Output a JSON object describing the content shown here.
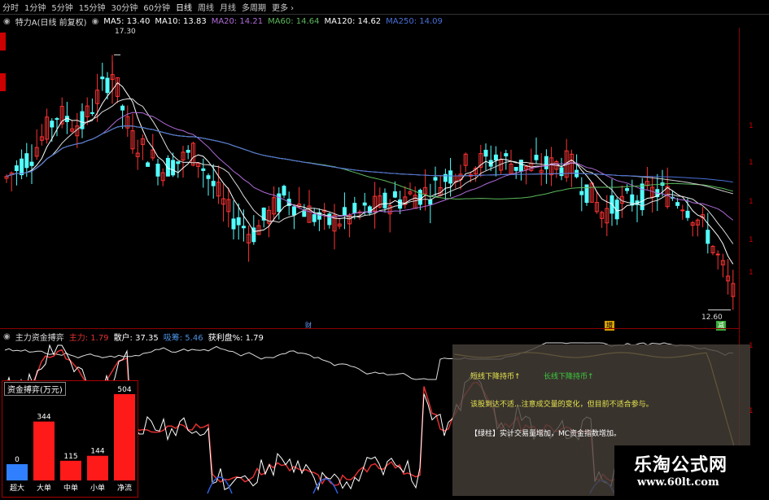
{
  "period_tabs": [
    {
      "label": "分时"
    },
    {
      "label": "1分钟"
    },
    {
      "label": "5分钟"
    },
    {
      "label": "15分钟"
    },
    {
      "label": "30分钟"
    },
    {
      "label": "60分钟"
    },
    {
      "label": "日线"
    },
    {
      "label": "周线"
    },
    {
      "label": "月线"
    },
    {
      "label": "多周期"
    },
    {
      "label": "更多 ›"
    }
  ],
  "main": {
    "title": "特力A(日线 前复权)",
    "ma": [
      {
        "label": "MA5: 13.40",
        "color": "#ffffff"
      },
      {
        "label": "MA10: 13.83",
        "color": "#ffffff"
      },
      {
        "label": "MA20: 14.21",
        "color": "#b06ad8"
      },
      {
        "label": "MA60: 14.64",
        "color": "#5cb85c"
      },
      {
        "label": "MA120: 14.62",
        "color": "#ffffff"
      },
      {
        "label": "MA250: 14.09",
        "color": "#4a70d8"
      }
    ],
    "high_label": "17.30",
    "low_label": "12.60",
    "markers": {
      "cai": "财",
      "zeng": "增",
      "jian": "减"
    }
  },
  "sub": {
    "title": "主力资金搏弈",
    "stats": [
      {
        "label": "主力: 1.79",
        "color": "#e03030"
      },
      {
        "label": "散户: 37.35",
        "color": "#ffffff"
      },
      {
        "label": "吸筹: 5.46",
        "color": "#4a90e0"
      },
      {
        "label": "获利盘%: 1.79",
        "color": "#ffffff"
      }
    ]
  },
  "fund_panel": {
    "title": "资金搏弈(万元)",
    "bars": [
      {
        "category": "超大",
        "value": 0,
        "label": "0",
        "color": "#2f7fff"
      },
      {
        "category": "大单",
        "value": 344,
        "label": "344",
        "color": "#ff1a1a"
      },
      {
        "category": "中单",
        "value": 115,
        "label": "115",
        "color": "#ff1a1a"
      },
      {
        "category": "小单",
        "value": 144,
        "label": "144",
        "color": "#ff1a1a"
      },
      {
        "category": "净流",
        "value": 504,
        "label": "504",
        "color": "#ff1a1a"
      }
    ]
  },
  "info_box": {
    "short_down": "短线下降持币↑",
    "long_down": "长线下降持币↑",
    "note": "该股到达不适...注意成交量的变化，但目前不适合参与。",
    "buy_line": "【绿柱】实计交易量增加，MC资金指数增加。"
  },
  "watermark": {
    "name": "乐淘公式网",
    "url": "www.60lt.com"
  },
  "colors": {
    "up": "#ff3333",
    "down": "#54ffff",
    "grid": "#8b0000"
  }
}
